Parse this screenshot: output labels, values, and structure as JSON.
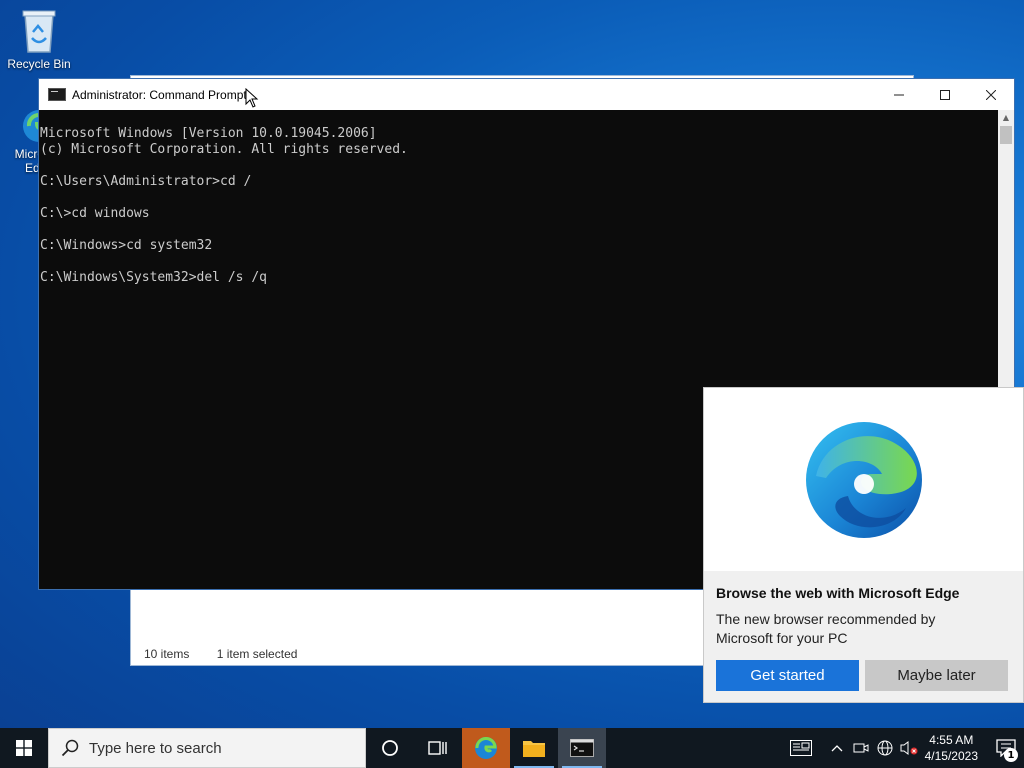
{
  "desktop": {
    "icons": [
      {
        "label": "Recycle Bin",
        "icon": "recycle-bin-icon"
      },
      {
        "label": "Microsoft Edge",
        "icon": "edge-icon"
      }
    ]
  },
  "explorer": {
    "status_items": "10 items",
    "status_selected": "1 item selected"
  },
  "cmd": {
    "title": "Administrator: Command Prompt",
    "lines": [
      "Microsoft Windows [Version 10.0.19045.2006]",
      "(c) Microsoft Corporation. All rights reserved.",
      "",
      "C:\\Users\\Administrator>cd /",
      "",
      "C:\\>cd windows",
      "",
      "C:\\Windows>cd system32",
      "",
      "C:\\Windows\\System32>del /s /q"
    ]
  },
  "toast": {
    "heading": "Browse the web with Microsoft Edge",
    "body": "The new browser recommended by Microsoft for your PC",
    "primary_label": "Get started",
    "secondary_label": "Maybe later",
    "colors": {
      "primary": "#1a73d9",
      "secondary": "#c8c8c8"
    }
  },
  "taskbar": {
    "search_placeholder": "Type here to search",
    "apps": [
      "task-view",
      "edge",
      "file-explorer",
      "command-prompt"
    ],
    "clock_time": "4:55 AM",
    "clock_date": "4/15/2023",
    "notification_count": "1"
  }
}
